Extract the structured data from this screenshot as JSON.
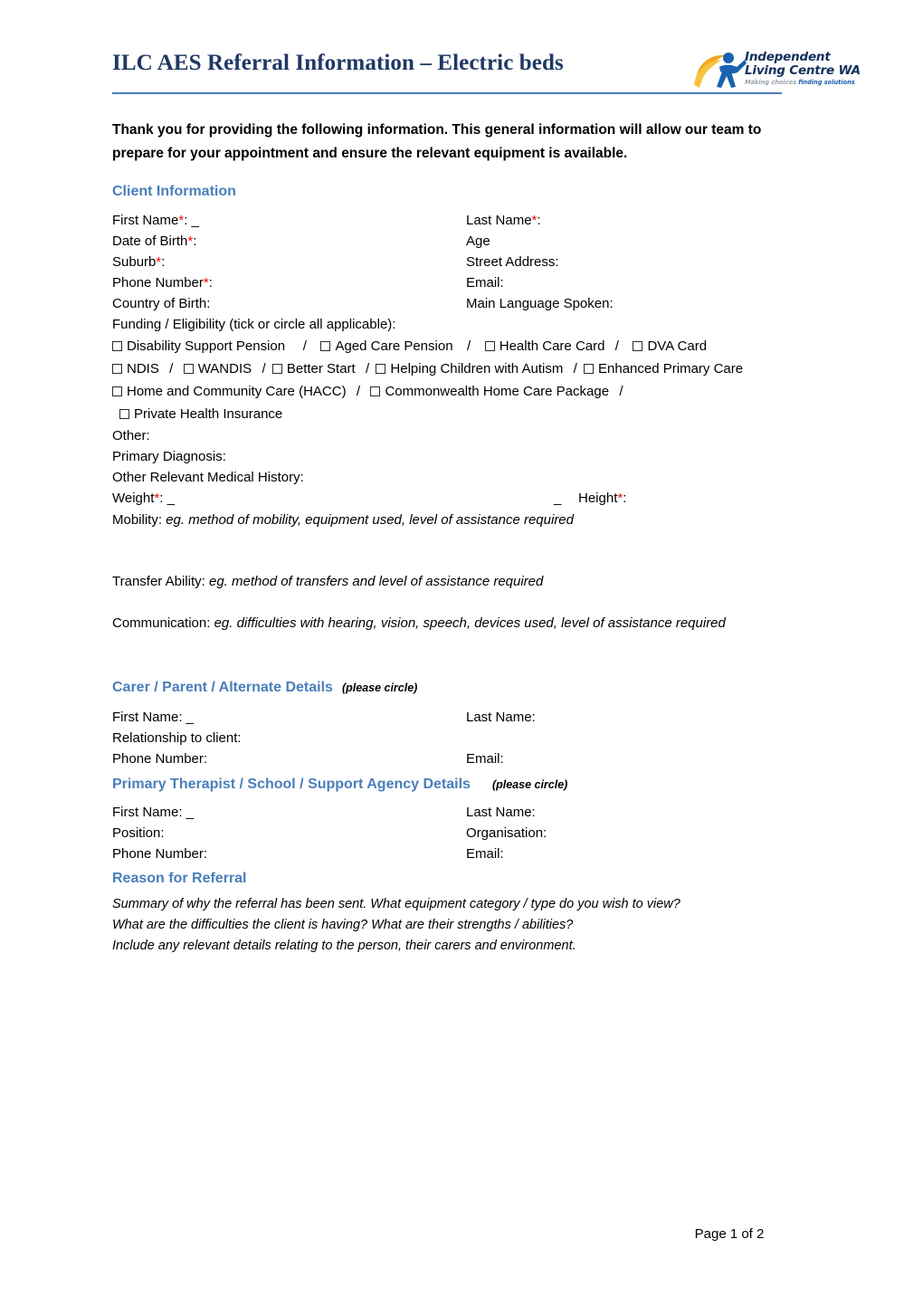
{
  "header": {
    "title": "ILC AES Referral Information – Electric beds",
    "logo": {
      "line1": "Independent",
      "line2": "Living Centre WA",
      "tagline_part1": "Making choices",
      "tagline_part2": "finding solutions"
    }
  },
  "intro": "Thank you for providing the following information. This general information will allow our team to prepare for your appointment and ensure the relevant equipment is available.",
  "sections": {
    "client": {
      "heading": "Client Information",
      "rows": [
        {
          "left": "First Name",
          "left_req": true,
          "left_suffix": ": _",
          "right": "Last Name",
          "right_req": true,
          "right_suffix": ":"
        },
        {
          "left": "Date of Birth",
          "left_req": true,
          "left_suffix": ":",
          "right": "Age",
          "right_req": false,
          "right_suffix": ""
        },
        {
          "left": "Suburb",
          "left_req": true,
          "left_suffix": ":",
          "right": "Street Address",
          "right_req": false,
          "right_suffix": ":"
        },
        {
          "left": "Phone Number",
          "left_req": true,
          "left_suffix": ":",
          "right": "Email",
          "right_req": false,
          "right_suffix": ":"
        },
        {
          "left": "Country of Birth",
          "left_req": false,
          "left_suffix": ":",
          "right": "Main Language Spoken",
          "right_req": false,
          "right_suffix": ":"
        }
      ],
      "funding_label": "Funding / Eligibility (tick or circle all applicable):",
      "funding_rows": [
        [
          "Disability Support Pension",
          "Aged Care Pension",
          "Health Care Card",
          "DVA Card"
        ],
        [
          "NDIS",
          "WANDIS",
          "Better Start",
          "Helping Children with Autism",
          "Enhanced Primary Care"
        ],
        [
          "Home and Community Care (HACC)",
          "Commonwealth Home Care Package"
        ],
        [
          "Private Health Insurance"
        ]
      ],
      "other_label": "Other:",
      "primary_diagnosis_label": "Primary Diagnosis:",
      "medical_history_label": "Other Relevant Medical History:",
      "weight_label": "Weight",
      "weight_suffix": ": _",
      "stray_underscore": "_",
      "height_label": "Height",
      "height_suffix": ":",
      "mobility_label": "Mobility:",
      "mobility_hint": "eg. method of mobility, equipment used, level of assistance required",
      "transfer_label": "Transfer Ability:",
      "transfer_hint": "eg. method of transfers and level of assistance required",
      "communication_label": "Communication:",
      "communication_hint": "eg. difficulties with hearing, vision, speech, devices used, level of assistance required"
    },
    "carer": {
      "heading": "Carer / Parent / Alternate Details",
      "note": "(please circle)",
      "rows": [
        {
          "left": "First Name: _",
          "right": "Last Name:"
        },
        {
          "left": "Relationship to client:",
          "right": ""
        },
        {
          "left": "Phone Number:",
          "right": "Email:"
        }
      ]
    },
    "therapist": {
      "heading": "Primary Therapist / School / Support Agency Details",
      "note": "(please circle)",
      "rows": [
        {
          "left": "First Name: _",
          "right": "Last Name:"
        },
        {
          "left": "Position:",
          "right": "Organisation:"
        },
        {
          "left": "Phone Number:",
          "right": "Email:"
        }
      ]
    },
    "referral": {
      "heading": "Reason for Referral",
      "lines": [
        "Summary of why the referral has been sent. What equipment category / type do you wish to view?",
        "What are the difficulties the client is having? What are their strengths / abilities?",
        "Include any relevant details relating to the person, their carers and environment."
      ]
    }
  },
  "footer": {
    "page_label": "Page 1 of 2"
  },
  "colors": {
    "heading_blue": "#4a7ebb",
    "title_navy": "#1F3864",
    "required_red": "#ff0000"
  }
}
